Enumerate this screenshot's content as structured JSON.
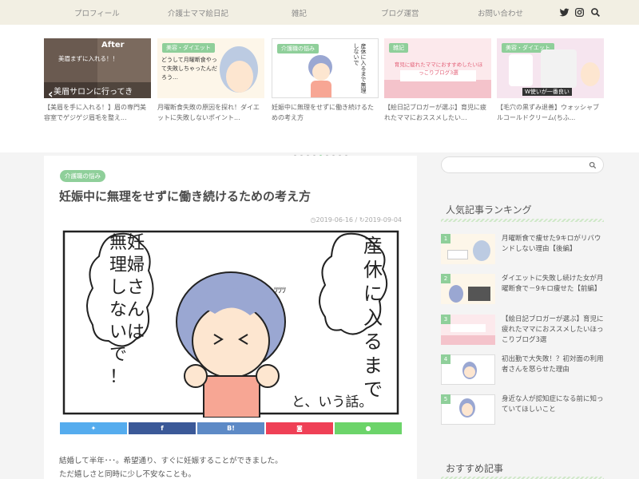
{
  "nav": {
    "items": [
      "プロフィール",
      "介護士ママ絵日記",
      "雑記",
      "ブログ運営",
      "お問い合わせ"
    ],
    "icons": [
      "twitter-icon",
      "instagram-icon",
      "search-icon"
    ]
  },
  "carousel": {
    "slides": [
      {
        "image_text": "美眉まずに入れる！！",
        "after_label": "After",
        "banner": "美眉サロンに行ってきた！！",
        "caption": "【美眉を手に入れる！】眉の専門美容室でゲジゲジ眉毛を整え..."
      },
      {
        "tag": "美容・ダイエット",
        "image_text": "どうして月曜断食やって失敗しちゃったんだろう…",
        "caption": "月曜断食失敗の原因を探れ！ダイエットに失敗しないポイント..."
      },
      {
        "tag": "介護職の悩み",
        "image_text": "産休に入るまで無理しないで",
        "caption": "妊娠中に無理をせずに働き続けるための考え方"
      },
      {
        "tag": "雑記",
        "image_text": "育児に疲れたママにおすすめしたいほっこりブログ3選",
        "caption": "【絵日記ブロガーが選ぶ】育児に疲れたママにおススメしたい..."
      },
      {
        "tag": "美容・ダイエット",
        "image_text": "W使いが一番良い",
        "caption": "【毛穴の黒ずみ退善】ウォッシャブルコールドクリーム(ちふ..."
      }
    ],
    "dot_count": 9
  },
  "article": {
    "category": "介護職の悩み",
    "title": "妊娠中に無理をせずに働き続けるための考え方",
    "published": "2019-06-16",
    "separator": "/",
    "updated": "2019-09-04",
    "hero": {
      "text_right": [
        "産",
        "休",
        "に",
        "入",
        "る",
        "ま",
        "で"
      ],
      "text_left": [
        "妊",
        "婦",
        "さ",
        "ん",
        "は"
      ],
      "text_left2": [
        "無",
        "理",
        "し",
        "な",
        "い",
        "で",
        "！"
      ],
      "bottom": "と、いう話。"
    },
    "share_labels": [
      "twitter",
      "facebook",
      "B!",
      "pocket",
      "line"
    ],
    "body": [
      "結婚して半年･･･。希望通り、すぐに妊娠することができました。",
      "ただ嬉しさと同時に少し不安なことも。"
    ]
  },
  "sidebar": {
    "search_placeholder": "",
    "ranking_heading": "人気記事ランキング",
    "ranking": [
      {
        "num": "1",
        "title": "月曜断食で痩せた9キロがリバウンドしない理由【後編】"
      },
      {
        "num": "2",
        "title": "ダイエットに失敗し続けた女が月曜断食で－9キロ痩せた【前編】"
      },
      {
        "num": "3",
        "title": "【絵日記ブロガーが選ぶ】育児に疲れたママにおススメしたいほっこりブログ3選"
      },
      {
        "num": "4",
        "title": "初出勤で大失敗！？初対面の利用者さんを怒らせた理由"
      },
      {
        "num": "5",
        "title": "身近な人が認知症になる前に知っていてほしいこと"
      }
    ],
    "recommend_heading": "おすすめ記事"
  },
  "colors": {
    "accent": "#8fcf9a",
    "twitter": "#55acee",
    "facebook": "#3b5998",
    "hatena": "#5d8ac6",
    "pocket": "#ef4056",
    "line": "#6cd46a"
  }
}
